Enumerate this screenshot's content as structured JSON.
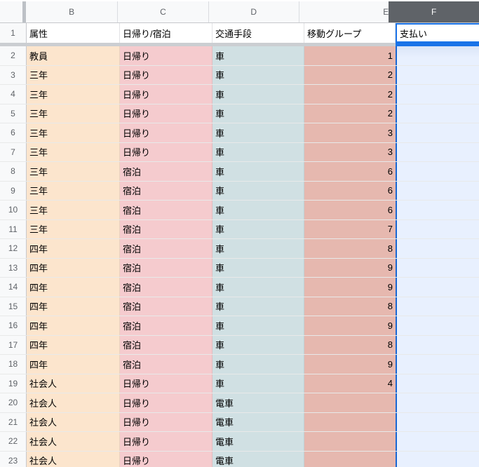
{
  "sheet": {
    "columns": [
      "B",
      "C",
      "D",
      "E",
      "F"
    ],
    "selected_column": "F",
    "selection": {
      "active_cell": "F1",
      "active_cell_value": "支払い",
      "selected_range": "F:F"
    },
    "header_row": {
      "number": "1",
      "cells": [
        "属性",
        "日帰り/宿泊",
        "交通手段",
        "移動グループ",
        "支払い"
      ]
    },
    "rows": [
      {
        "number": "2",
        "cells": [
          "教員",
          "日帰り",
          "車",
          "1"
        ]
      },
      {
        "number": "3",
        "cells": [
          "三年",
          "日帰り",
          "車",
          "2"
        ]
      },
      {
        "number": "4",
        "cells": [
          "三年",
          "日帰り",
          "車",
          "2"
        ]
      },
      {
        "number": "5",
        "cells": [
          "三年",
          "日帰り",
          "車",
          "2"
        ]
      },
      {
        "number": "6",
        "cells": [
          "三年",
          "日帰り",
          "車",
          "3"
        ]
      },
      {
        "number": "7",
        "cells": [
          "三年",
          "日帰り",
          "車",
          "3"
        ]
      },
      {
        "number": "8",
        "cells": [
          "三年",
          "宿泊",
          "車",
          "6"
        ]
      },
      {
        "number": "9",
        "cells": [
          "三年",
          "宿泊",
          "車",
          "6"
        ]
      },
      {
        "number": "10",
        "cells": [
          "三年",
          "宿泊",
          "車",
          "6"
        ]
      },
      {
        "number": "11",
        "cells": [
          "三年",
          "宿泊",
          "車",
          "7"
        ]
      },
      {
        "number": "12",
        "cells": [
          "四年",
          "宿泊",
          "車",
          "8"
        ]
      },
      {
        "number": "13",
        "cells": [
          "四年",
          "宿泊",
          "車",
          "9"
        ]
      },
      {
        "number": "14",
        "cells": [
          "四年",
          "宿泊",
          "車",
          "9"
        ]
      },
      {
        "number": "15",
        "cells": [
          "四年",
          "宿泊",
          "車",
          "8"
        ]
      },
      {
        "number": "16",
        "cells": [
          "四年",
          "宿泊",
          "車",
          "9"
        ]
      },
      {
        "number": "17",
        "cells": [
          "四年",
          "宿泊",
          "車",
          "8"
        ]
      },
      {
        "number": "18",
        "cells": [
          "四年",
          "宿泊",
          "車",
          "9"
        ]
      },
      {
        "number": "19",
        "cells": [
          "社会人",
          "日帰り",
          "車",
          "4"
        ]
      },
      {
        "number": "20",
        "cells": [
          "社会人",
          "日帰り",
          "電車",
          ""
        ]
      },
      {
        "number": "21",
        "cells": [
          "社会人",
          "日帰り",
          "電車",
          ""
        ]
      },
      {
        "number": "22",
        "cells": [
          "社会人",
          "日帰り",
          "電車",
          ""
        ]
      },
      {
        "number": "23",
        "cells": [
          "社会人",
          "日帰り",
          "電車",
          ""
        ]
      }
    ]
  },
  "colors": {
    "col-b-fill": "#fce5cd",
    "col-c-fill": "#f5cbce",
    "col-d-fill": "#d0e0e3",
    "col-e-fill": "#e6b8af",
    "selected-col-fill": "#e8f0fe",
    "selection-blue": "#1a73e8",
    "selection-range-border": "#1967d2",
    "selected-header-bg": "#5f6368",
    "selected-header-text": "#ffffff",
    "header-bg": "#f8f9fa",
    "header-border": "#c6c8cc",
    "header-separator": "#dadce0",
    "header-text": "#5f6368",
    "frozen-bar": "#bdc1c6",
    "frozen-divider": "#cbced2",
    "cell-text": "#000000"
  }
}
